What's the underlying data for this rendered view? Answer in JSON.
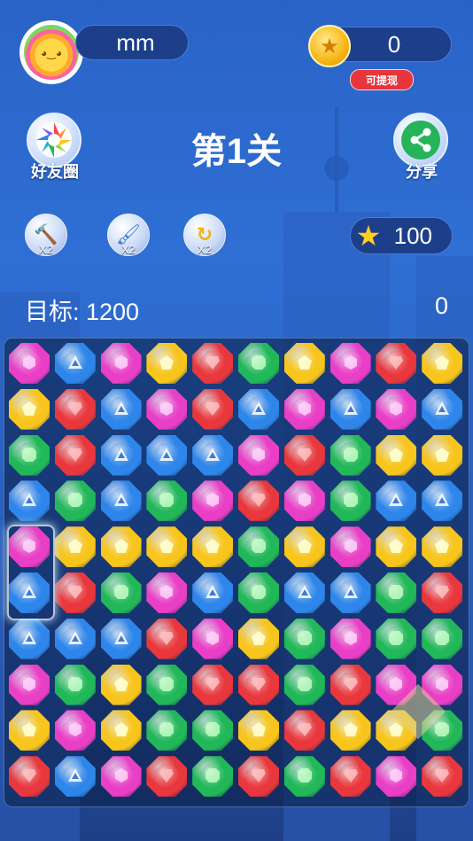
{
  "player": {
    "name": "mm"
  },
  "coins": {
    "value": "0",
    "withdraw_label": "可提现"
  },
  "level": {
    "title": "第1关"
  },
  "buttons": {
    "friends_label": "好友圈",
    "share_label": "分享"
  },
  "powerups": [
    {
      "icon": "hammer-icon",
      "count": "X2"
    },
    {
      "icon": "brush-icon",
      "count": "X2"
    },
    {
      "icon": "refresh-icon",
      "count": "X2"
    }
  ],
  "stars": {
    "value": "100"
  },
  "target": {
    "label": "目标: 1200",
    "score": "0"
  },
  "colors": {
    "pink": "#e93fc6",
    "blue": "#2f86ea",
    "yellow": "#f7c51c",
    "red": "#e8383d",
    "green": "#22b859"
  },
  "board": {
    "rows": [
      [
        "P",
        "B",
        "P",
        "Y",
        "R",
        "G",
        "Y",
        "P",
        "R",
        "Y"
      ],
      [
        "Y",
        "R",
        "B",
        "P",
        "R",
        "B",
        "P",
        "B",
        "P",
        "B"
      ],
      [
        "G",
        "R",
        "B",
        "B",
        "B",
        "P",
        "R",
        "G",
        "Y",
        "Y"
      ],
      [
        "B",
        "G",
        "B",
        "G",
        "P",
        "R",
        "P",
        "G",
        "B",
        "B"
      ],
      [
        "P",
        "Y",
        "Y",
        "Y",
        "Y",
        "G",
        "Y",
        "P",
        "Y",
        "Y"
      ],
      [
        "B",
        "R",
        "G",
        "P",
        "B",
        "G",
        "B",
        "B",
        "G",
        "R"
      ],
      [
        "B",
        "B",
        "B",
        "R",
        "P",
        "Y",
        "G",
        "P",
        "G",
        "G"
      ],
      [
        "P",
        "G",
        "Y",
        "G",
        "R",
        "R",
        "G",
        "R",
        "P",
        "P"
      ],
      [
        "Y",
        "P",
        "Y",
        "G",
        "G",
        "Y",
        "R",
        "Y",
        "Y",
        "G"
      ],
      [
        "R",
        "B",
        "P",
        "R",
        "G",
        "R",
        "G",
        "R",
        "P",
        "R"
      ]
    ]
  }
}
